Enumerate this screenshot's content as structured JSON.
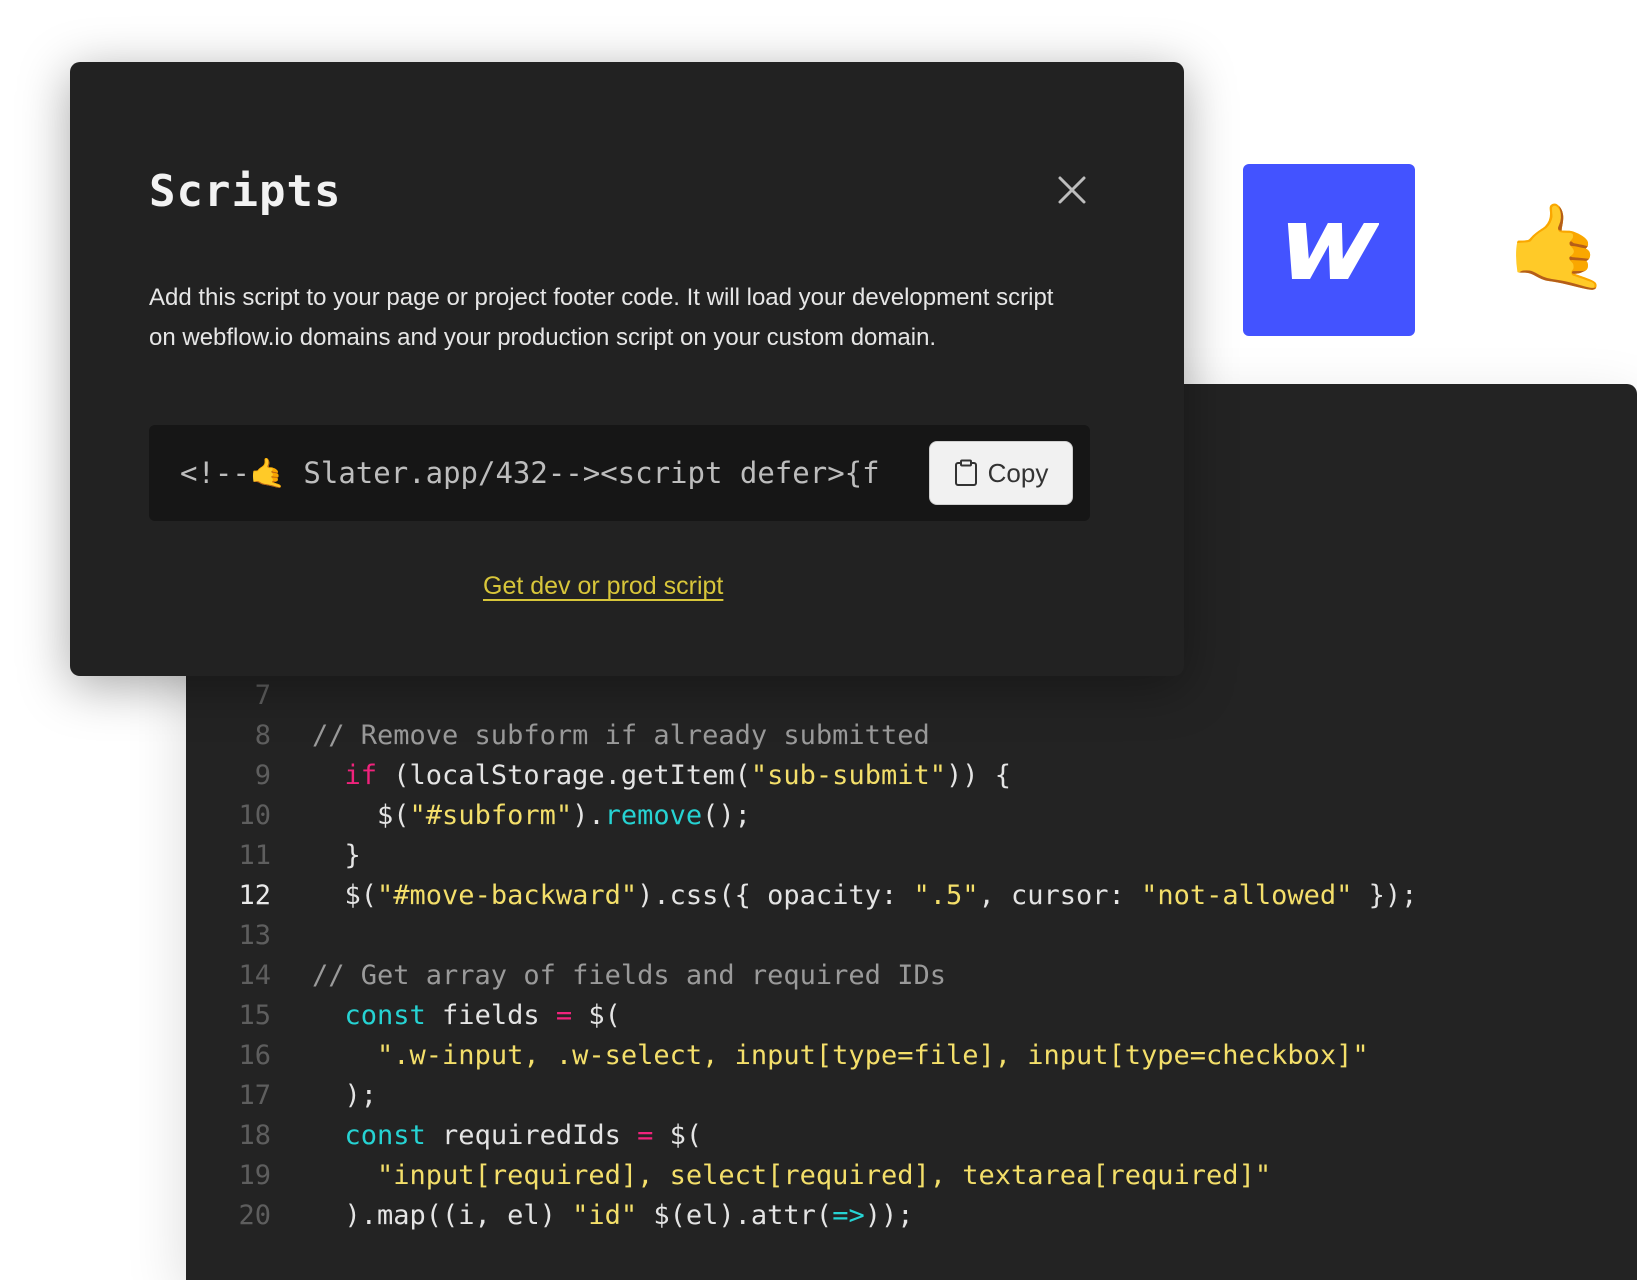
{
  "modal": {
    "title": "Scripts",
    "description": "Add this script to your page or project footer code. It will load your development script on webflow.io domains and your production script on your custom domain.",
    "snippet": "<!--🤙 Slater.app/432--><script defer>{f",
    "copy_label": "Copy",
    "link_label": "Get dev or prod script"
  },
  "brand": {
    "webflow_color": "#4353ff",
    "webflow_letter": "W",
    "hand_emoji": "🤙"
  },
  "code": {
    "active_line": "12",
    "lines": [
      {
        "n": "7"
      },
      {
        "n": "8",
        "comment": "// Remove subform if already submitted"
      },
      {
        "n": "9",
        "indent": "  ",
        "kw": "if",
        "a": " (localStorage.getItem(",
        "s": "\"sub-submit\"",
        "b": ")) {"
      },
      {
        "n": "10",
        "indent": "    ",
        "a": "$(",
        "s": "\"#subform\"",
        "b": ").",
        "fn": "remove",
        "c": "();"
      },
      {
        "n": "11",
        "indent": "  ",
        "a": "}"
      },
      {
        "n": "12",
        "indent": "  ",
        "a": "$(",
        "s": "\"#move-backward\"",
        "b": ").css({ opacity: ",
        "s2": "\".5\"",
        "c": ", cursor: ",
        "s3": "\"not-allowed\"",
        "d": " });"
      },
      {
        "n": "13"
      },
      {
        "n": "14",
        "comment": "// Get array of fields and required IDs"
      },
      {
        "n": "15",
        "indent": "  ",
        "kw2": "const",
        "a": " fields ",
        "op": "=",
        "b": " $("
      },
      {
        "n": "16",
        "indent": "    ",
        "s": "\".w-input, .w-select, input[type=file], input[type=checkbox]\""
      },
      {
        "n": "17",
        "indent": "  ",
        "a": ");"
      },
      {
        "n": "18",
        "indent": "  ",
        "kw2": "const",
        "a": " requiredIds ",
        "op": "=",
        "b": " $("
      },
      {
        "n": "19",
        "indent": "    ",
        "s": "\"input[required], select[required], textarea[required]\""
      },
      {
        "n": "20",
        "indent": "  ",
        "a": ").map((i, el) ",
        "arrow": "=>",
        "b": " $(el).attr(",
        "s": "\"id\"",
        "c": "));"
      }
    ]
  }
}
